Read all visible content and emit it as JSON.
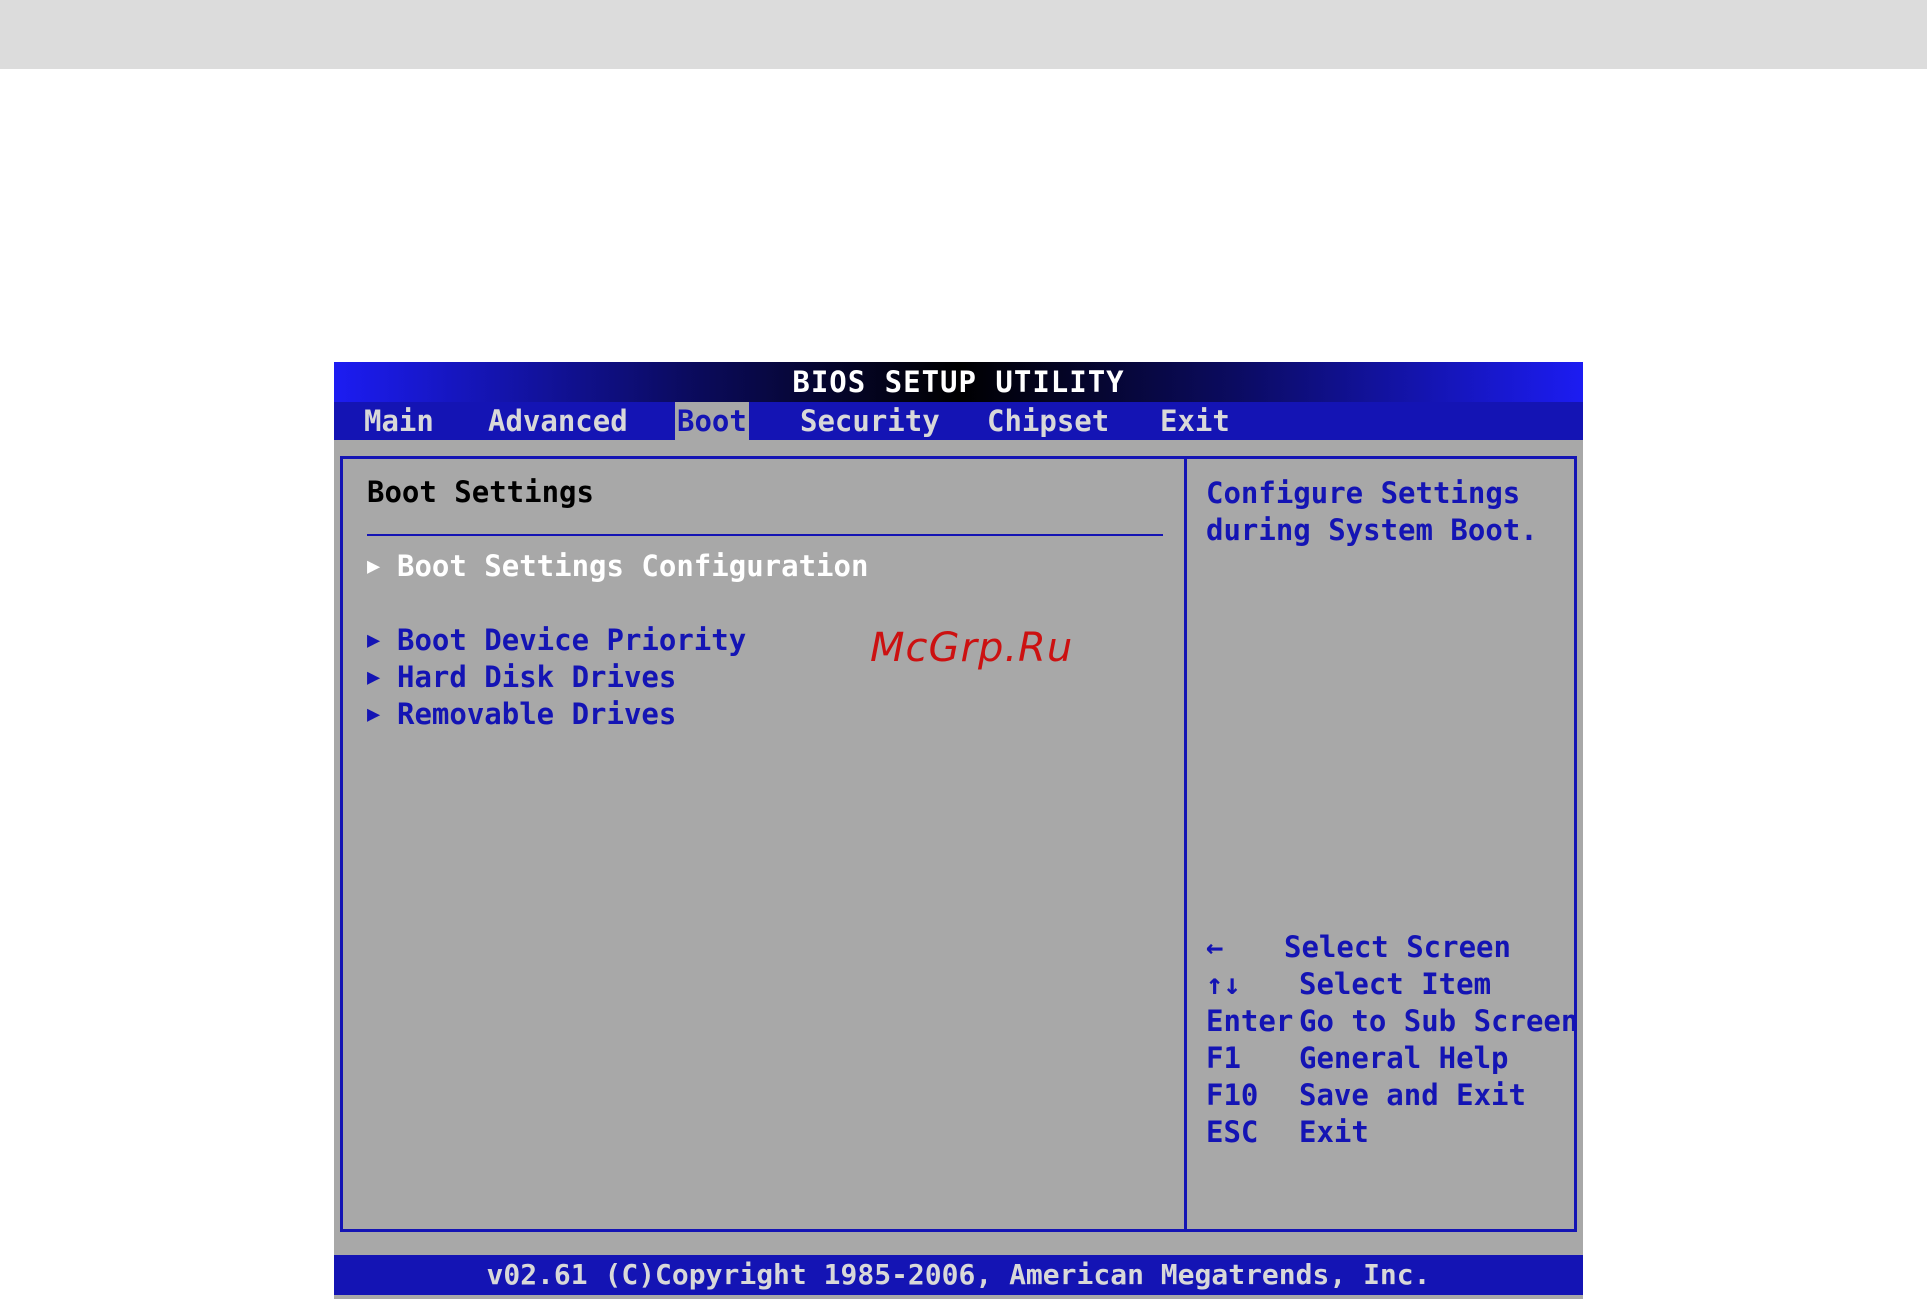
{
  "title": "BIOS SETUP UTILITY",
  "menu": [
    {
      "label": "Main"
    },
    {
      "label": "Advanced"
    },
    {
      "label": "Boot"
    },
    {
      "label": "Security"
    },
    {
      "label": "Chipset"
    },
    {
      "label": "Exit"
    }
  ],
  "active_menu": "Boot",
  "left_panel": {
    "title": "Boot Settings",
    "entries": [
      {
        "label": "Boot Settings Configuration",
        "selected": true
      },
      {
        "label": "Boot Device Priority"
      },
      {
        "label": "Hard Disk Drives"
      },
      {
        "label": "Removable Drives"
      }
    ]
  },
  "right_panel": {
    "help_line1": "Configure Settings",
    "help_line2": "during System Boot.",
    "keys": [
      {
        "key": "←",
        "action": "Select Screen"
      },
      {
        "key": "↑↓",
        "action": "Select Item"
      },
      {
        "key": "Enter",
        "action": "Go to Sub Screen"
      },
      {
        "key": "F1",
        "action": "General Help"
      },
      {
        "key": "F10",
        "action": "Save and Exit"
      },
      {
        "key": "ESC",
        "action": "Exit"
      }
    ]
  },
  "footer": "v02.61 (C)Copyright 1985-2006, American Megatrends, Inc.",
  "watermark": "McGrp.Ru",
  "colors": {
    "panel_bg": "#a8a8a8",
    "bios_blue": "#1414b4",
    "watermark_red": "#cc1111"
  },
  "icons": {
    "submenu_arrow": "triangle-right-icon",
    "left_arrow": "arrow-left-icon",
    "up_down_arrows": "arrow-up-down-icon"
  }
}
